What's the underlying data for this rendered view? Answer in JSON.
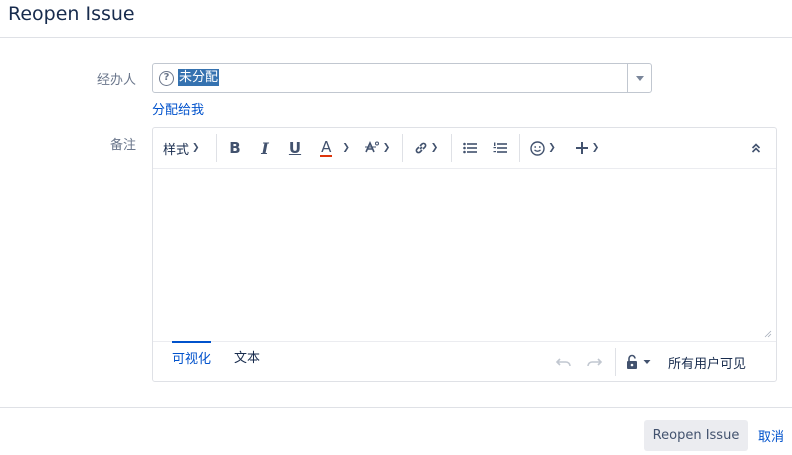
{
  "dialog": {
    "title": "Reopen Issue"
  },
  "form": {
    "assignee_label": "经办人",
    "assignee_value": "未分配",
    "assign_to_me": "分配给我",
    "comment_label": "备注"
  },
  "toolbar": {
    "style_label": "样式",
    "bold_label": "B",
    "italic_label": "I",
    "underline_label": "U",
    "text_color_label": "A",
    "text_color_underline": "#de350b"
  },
  "editor": {
    "tabs": [
      {
        "label": "可视化",
        "active": true
      },
      {
        "label": "文本",
        "active": false
      }
    ],
    "visibility": "所有用户可见"
  },
  "actions": {
    "submit_label": "Reopen Issue",
    "cancel_label": "取消"
  },
  "colors": {
    "link": "#0052cc",
    "selection": "#3572b0",
    "border": "#dfe1e6"
  }
}
